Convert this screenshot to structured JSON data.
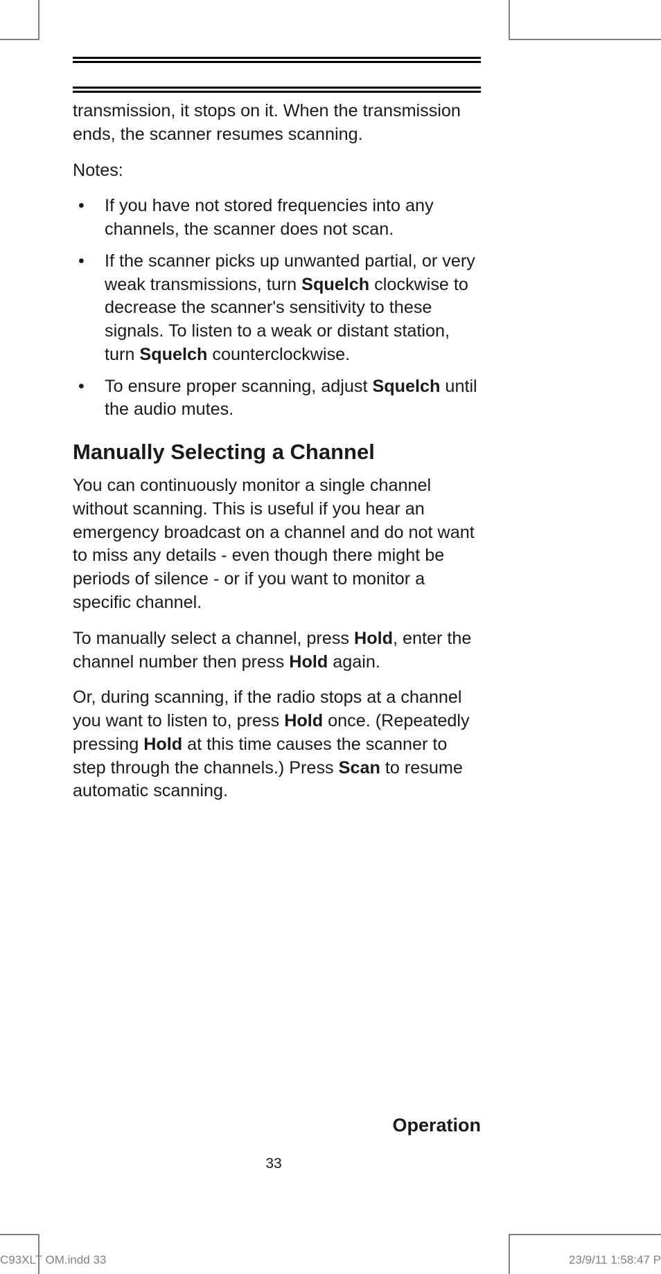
{
  "body": {
    "intro": "transmission, it stops on it. When the transmission ends, the scanner resumes scanning.",
    "notes_label": "Notes:",
    "notes": [
      "If you have not stored frequencies into any channels, the scanner does not scan.",
      "If the scanner picks up unwanted partial, or very weak transmissions, turn Squelch clockwise to decrease the scanner's sensitivity to these signals. To listen to a weak or distant station, turn Squelch counterclockwise.",
      "To ensure proper scanning, adjust Squelch until the audio mutes."
    ],
    "heading": "Manually Selecting a Channel",
    "para1": "You can continuously monitor a single channel without scanning. This is useful if you hear an emergency broadcast on a channel and do not want to miss any details - even though there might be periods of silence - or if you want to monitor a specific channel.",
    "para2": "To manually select a channel, press Hold, enter the channel number then press Hold again.",
    "para3": "Or, during scanning, if the radio stops at a channel you want to listen to, press Hold once. (Repeatedly pressing Hold at this time causes the scanner to step through the channels.) Press Scan to resume automatic scanning."
  },
  "footer": {
    "section": "Operation",
    "page_number": "33",
    "slug_left": "C93XLT OM.indd   33",
    "slug_right": "23/9/11   1:58:47 P"
  },
  "bold_words": [
    "Squelch",
    "Hold",
    "Scan"
  ]
}
